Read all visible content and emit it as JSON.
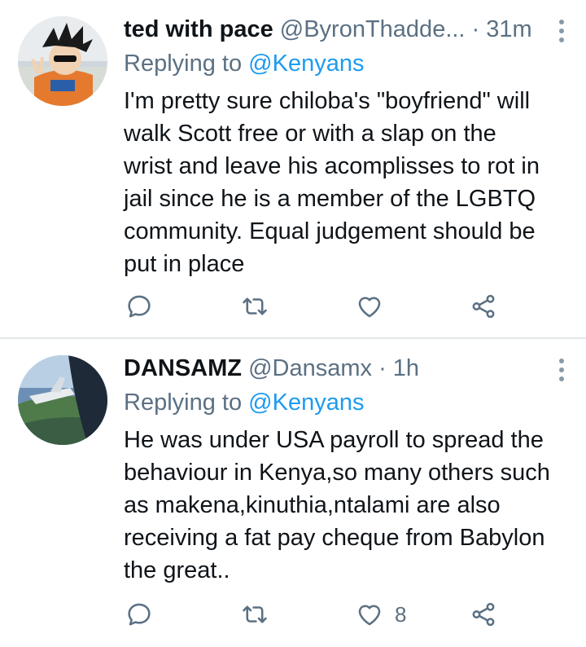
{
  "tweets": [
    {
      "name": "ted with pace",
      "handle": "@ByronThadde...",
      "separator": "·",
      "time": "31m",
      "replying_prefix": "Replying to",
      "replying_to": "@Kenyans",
      "body_lines": [
        "I'm pretty sure chiloba's \"boyfriend\" will",
        "walk Scott free or with a slap on the",
        "wrist and leave his acomplisses to rot in",
        "jail since he is a member of the LGBTQ",
        "community.  Equal judgement should be",
        "put in place"
      ],
      "like_count": ""
    },
    {
      "name": "DANSAMZ",
      "handle": "@Dansamx",
      "separator": "·",
      "time": "1h",
      "replying_prefix": "Replying to",
      "replying_to": "@Kenyans",
      "body_lines": [
        "He was under USA payroll to spread the",
        "behaviour in Kenya,so many others such",
        "as makena,kinuthia,ntalami are also",
        "receiving a fat pay cheque from Babylon",
        "the great.."
      ],
      "like_count": "8"
    }
  ],
  "icons": {
    "reply": "reply-icon",
    "retweet": "retweet-icon",
    "like": "heart-icon",
    "share": "share-icon",
    "more": "more-vertical-icon"
  },
  "colors": {
    "text": "#0f1419",
    "secondary": "#5b7083",
    "link": "#1d9bf0",
    "divider": "#e3e7ea"
  }
}
